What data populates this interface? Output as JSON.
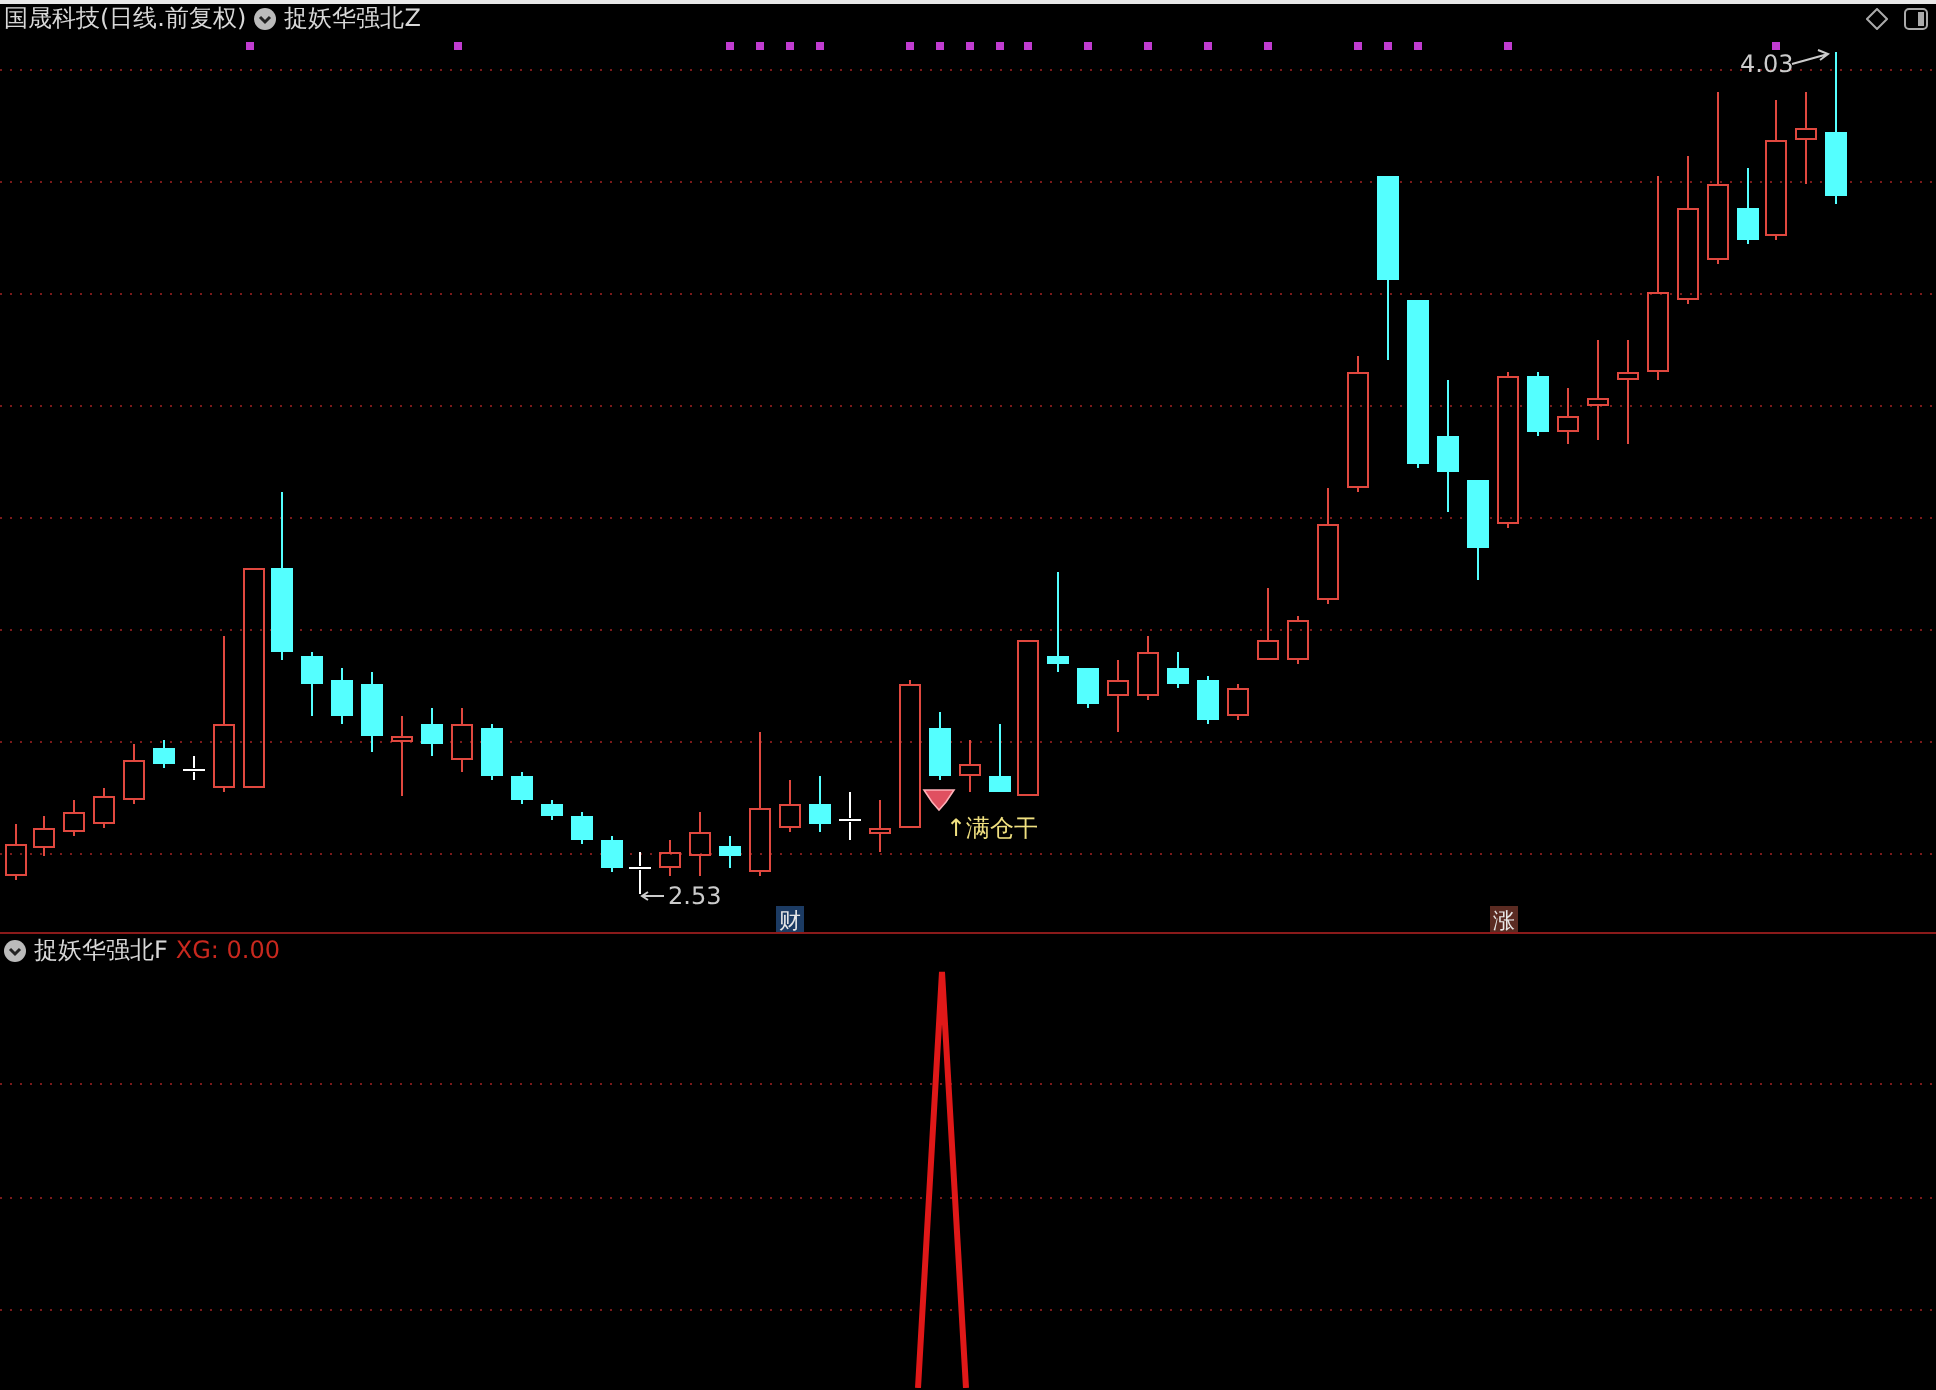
{
  "header": {
    "security": "国晟科技(日线.前复权)",
    "indicator": "捉妖华强北Z"
  },
  "main_chart": {
    "high_label": "4.03",
    "low_label": "2.53",
    "signal_label": "↑满仓干",
    "markers": [
      {
        "text": "财",
        "color": "#1c3b63"
      },
      {
        "text": "涨",
        "color": "#5b2b22"
      }
    ]
  },
  "sub_panel": {
    "indicator": "捉妖华强北F",
    "reading": "XG: 0.00"
  }
}
